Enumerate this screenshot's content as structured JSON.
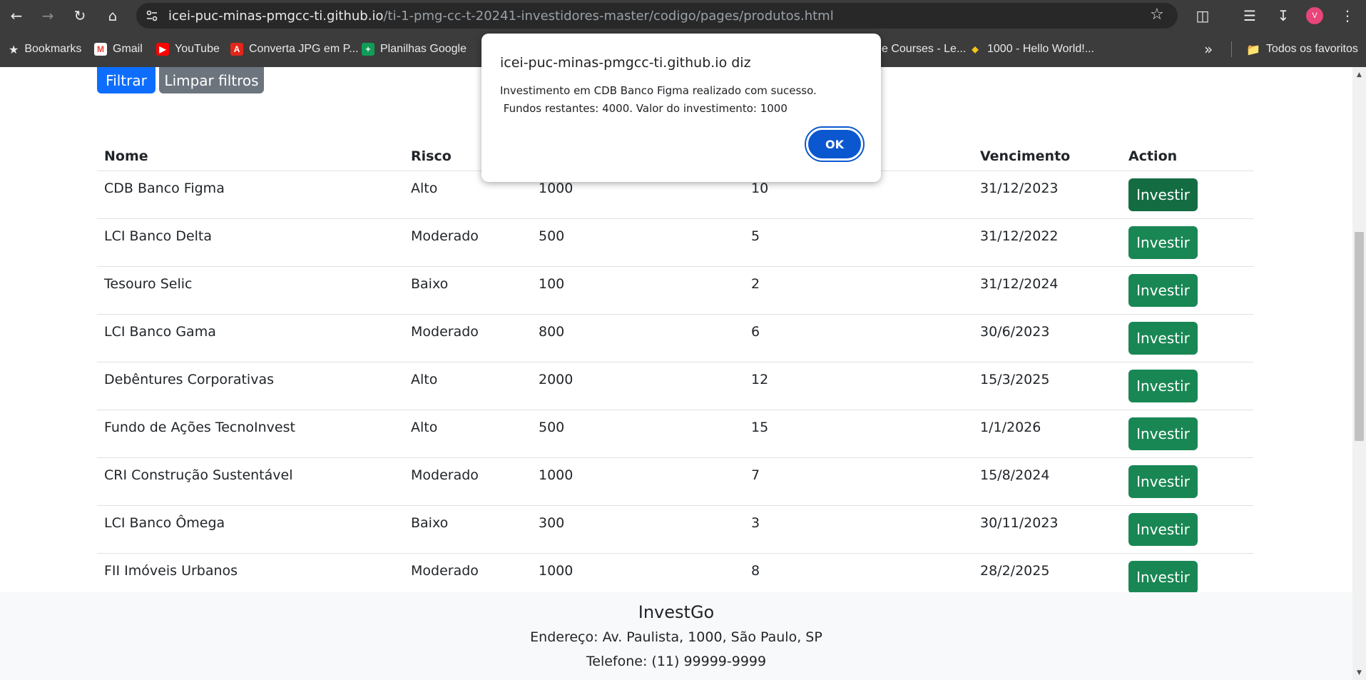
{
  "browser": {
    "url_host": "icei-puc-minas-pmgcc-ti.github.io",
    "url_path": "/ti-1-pmg-cc-t-20241-investidores-master/codigo/pages/produtos.html",
    "avatar_letter": "V"
  },
  "bookmarks": {
    "items": [
      {
        "label": "Bookmarks",
        "icon": "star-icon"
      },
      {
        "label": "Gmail",
        "icon": "gmail-icon",
        "color": "#ea4335"
      },
      {
        "label": "YouTube",
        "icon": "youtube-icon",
        "color": "#ff0000"
      },
      {
        "label": "Converta JPG em P...",
        "icon": "adobe-icon",
        "color": "#e3261a"
      },
      {
        "label": "Planilhas Google",
        "icon": "sheets-icon",
        "color": "#0f9d58"
      },
      {
        "label": "e Courses - Le...",
        "icon": "course-icon"
      },
      {
        "label": "1000 - Hello World!...",
        "icon": "hello-icon",
        "color": "#f5c518"
      }
    ],
    "all_favorites": "Todos os favoritos"
  },
  "filters": {
    "filter_label": "Filtrar",
    "clear_label": "Limpar filtros"
  },
  "table": {
    "headers": [
      "Nome",
      "Risco",
      "",
      "",
      "Vencimento",
      "Action"
    ],
    "action_label": "Investir",
    "rows": [
      [
        "CDB Banco Figma",
        "Alto",
        "1000",
        "10",
        "31/12/2023"
      ],
      [
        "LCI Banco Delta",
        "Moderado",
        "500",
        "5",
        "31/12/2022"
      ],
      [
        "Tesouro Selic",
        "Baixo",
        "100",
        "2",
        "31/12/2024"
      ],
      [
        "LCI Banco Gama",
        "Moderado",
        "800",
        "6",
        "30/6/2023"
      ],
      [
        "Debêntures Corporativas",
        "Alto",
        "2000",
        "12",
        "15/3/2025"
      ],
      [
        "Fundo de Ações TecnoInvest",
        "Alto",
        "500",
        "15",
        "1/1/2026"
      ],
      [
        "CRI Construção Sustentável",
        "Moderado",
        "1000",
        "7",
        "15/8/2024"
      ],
      [
        "LCI Banco Ômega",
        "Baixo",
        "300",
        "3",
        "30/11/2023"
      ],
      [
        "FII Imóveis Urbanos",
        "Moderado",
        "1000",
        "8",
        "28/2/2025"
      ]
    ]
  },
  "footer": {
    "brand": "InvestGo",
    "address": "Endereço: Av. Paulista, 1000, São Paulo, SP",
    "phone": "Telefone: (11) 99999-9999"
  },
  "dialog": {
    "title": "icei-puc-minas-pmgcc-ti.github.io diz",
    "line1": "Investimento em CDB Banco Figma realizado com sucesso.",
    "line2": " Fundos restantes: 4000. Valor do investimento: 1000",
    "ok_label": "OK"
  }
}
